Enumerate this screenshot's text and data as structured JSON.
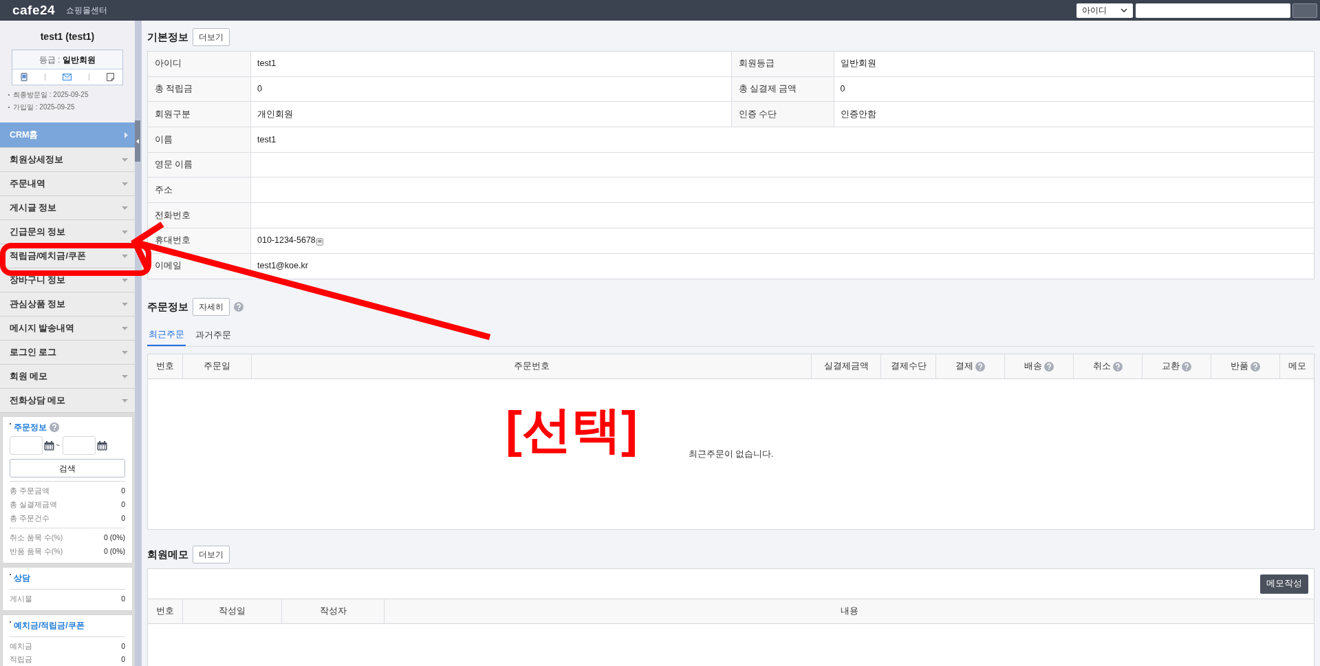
{
  "topbar": {
    "logo": "cafe24",
    "title": "쇼핑몰센터",
    "search_type": "아이디"
  },
  "profile": {
    "name": "test1 (test1)",
    "grade_label": "등급 :",
    "grade": "일반회원",
    "dates": [
      "최종방문일 : 2025-09-25",
      "가입일 : 2025-09-25"
    ]
  },
  "menu": [
    {
      "label": "CRM홈",
      "selected": true
    },
    {
      "label": "회원상세정보",
      "selected": false
    },
    {
      "label": "주문내역",
      "selected": false
    },
    {
      "label": "게시글 정보",
      "selected": false
    },
    {
      "label": "긴급문의 정보",
      "selected": false
    },
    {
      "label": "적립금/예치금/쿠폰",
      "selected": false
    },
    {
      "label": "장바구니 정보",
      "selected": false
    },
    {
      "label": "관심상품 정보",
      "selected": false
    },
    {
      "label": "메시지 발송내역",
      "selected": false
    },
    {
      "label": "로그인 로그",
      "selected": false
    },
    {
      "label": "회원 메모",
      "selected": false
    },
    {
      "label": "전화상담 메모",
      "selected": false
    }
  ],
  "widgets": [
    {
      "title": "주문정보",
      "help": true,
      "date_range": {
        "separator": "~",
        "button": "검색"
      },
      "groups": [
        [
          {
            "label": "총 주문금액",
            "value": "0"
          },
          {
            "label": "총 실결제금액",
            "value": "0"
          },
          {
            "label": "총 주문건수",
            "value": "0"
          }
        ],
        [
          {
            "label": "취소 품목 수(%)",
            "value": "0 (0%)"
          },
          {
            "label": "반품 품목 수(%)",
            "value": "0 (0%)"
          }
        ]
      ]
    },
    {
      "title": "상담",
      "help": false,
      "groups": [
        [
          {
            "label": "게시물",
            "value": "0"
          }
        ]
      ]
    },
    {
      "title": "예치금/적립금/쿠폰",
      "help": false,
      "groups": [
        [
          {
            "label": "예치금",
            "value": "0"
          },
          {
            "label": "적립금",
            "value": "0"
          }
        ]
      ]
    }
  ],
  "basic_info": {
    "title": "기본정보",
    "button": "더보기",
    "rows": [
      {
        "cells": [
          {
            "label": "아이디",
            "value": "test1"
          },
          {
            "label": "회원등급",
            "value": "일반회원"
          }
        ]
      },
      {
        "cells": [
          {
            "label": "총 적립금",
            "value": "0"
          },
          {
            "label": "총 실결제 금액",
            "value": "0"
          }
        ]
      },
      {
        "cells": [
          {
            "label": "회원구분",
            "value": "개인회원"
          },
          {
            "label": "인증 수단",
            "value": "인증안함"
          }
        ]
      },
      {
        "cells": [
          {
            "label": "이름",
            "value": "test1"
          }
        ]
      },
      {
        "cells": [
          {
            "label": "영문 이름"
          }
        ]
      },
      {
        "cells": [
          {
            "label": "주소"
          }
        ]
      },
      {
        "cells": [
          {
            "label": "전화번호"
          }
        ]
      },
      {
        "cells": [
          {
            "label": "휴대번호",
            "value": "010-1234-5678",
            "sms": true
          }
        ]
      },
      {
        "cells": [
          {
            "label": "이메일",
            "value": "test1@koe.kr"
          }
        ]
      }
    ]
  },
  "order_info": {
    "title": "주문정보",
    "button": "자세히",
    "help": true,
    "tabs": [
      {
        "label": "최근주문",
        "selected": true
      },
      {
        "label": "과거주문",
        "selected": false
      }
    ],
    "columns": [
      {
        "label": "번호",
        "help": false
      },
      {
        "label": "주문일",
        "help": false
      },
      {
        "label": "주문번호",
        "help": false
      },
      {
        "label": "실결제금액",
        "help": false
      },
      {
        "label": "결제수단",
        "help": false
      },
      {
        "label": "결제",
        "help": true
      },
      {
        "label": "배송",
        "help": true
      },
      {
        "label": "취소",
        "help": true
      },
      {
        "label": "교환",
        "help": true
      },
      {
        "label": "반품",
        "help": true
      },
      {
        "label": "메모",
        "help": false
      }
    ],
    "empty": "최근주문이 없습니다."
  },
  "memo": {
    "title": "회원메모",
    "button": "더보기",
    "write_button": "메모작성",
    "columns": [
      "번호",
      "작성일",
      "작성자",
      "내용"
    ]
  },
  "annotation": {
    "text": "[선택]"
  }
}
